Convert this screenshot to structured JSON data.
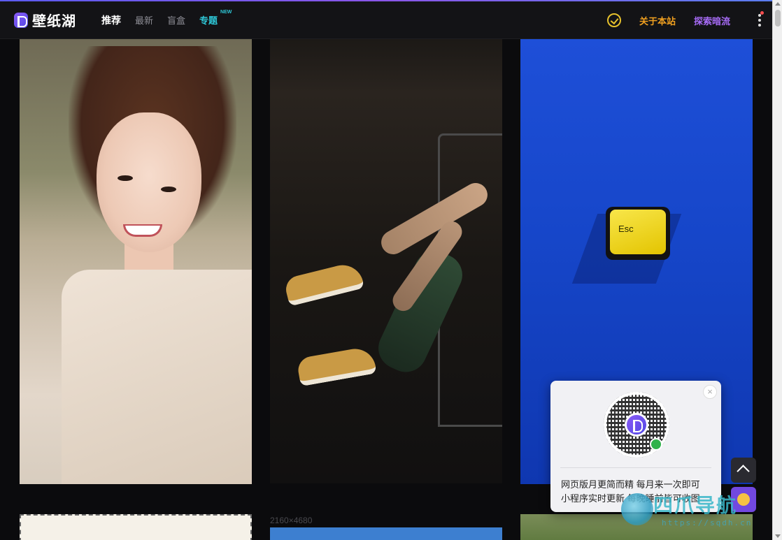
{
  "header": {
    "logo_text": "壁纸湖",
    "nav": [
      {
        "label": "推荐"
      },
      {
        "label": "最新"
      },
      {
        "label": "盲盒"
      },
      {
        "label": "专题",
        "badge": "NEW"
      }
    ],
    "about_label": "关于本站",
    "explore_label": "探索暗流"
  },
  "wallpapers": [
    {
      "label": "portrait"
    },
    {
      "label": "sneakers"
    },
    {
      "label": "esc-key",
      "key_text": "Esc"
    }
  ],
  "second_row": {
    "resolution": "2160×4680"
  },
  "popup": {
    "line1": "网页版月更简而精 每月来一次即可",
    "line2": "小程序实时更新 每晚睡前皆可收图",
    "close_symbol": "×"
  },
  "watermark": {
    "name": "四爪导航",
    "url": "https://sqdh.cn"
  },
  "colors": {
    "accent_purple": "#a66bf5",
    "accent_orange": "#f0a020",
    "accent_cyan": "#2ec8d8",
    "verify_yellow": "#e6c12c"
  }
}
